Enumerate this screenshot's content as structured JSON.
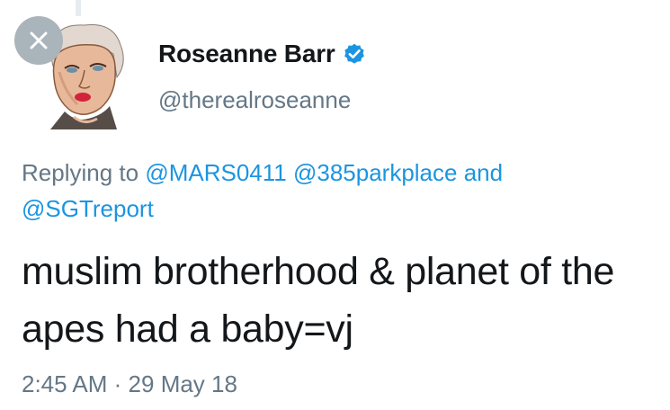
{
  "tweet": {
    "display_name": "Roseanne Barr",
    "handle": "@therealroseanne",
    "verified_icon": "verified-badge-icon",
    "reply_prefix": "Replying to",
    "mention_1": "@MARS0411",
    "mention_2": "@385parkplace",
    "and_text": "and",
    "mention_3": "@SGTreport",
    "text": "muslim brotherhood & planet of the apes had a baby=vj",
    "time": "2:45 AM",
    "separator": "·",
    "date": "29 May 18"
  },
  "close_icon": "close-icon",
  "colors": {
    "link": "#1b95e0",
    "text": "#14171a",
    "secondary": "#657786",
    "close_bg": "#aab4bb"
  }
}
